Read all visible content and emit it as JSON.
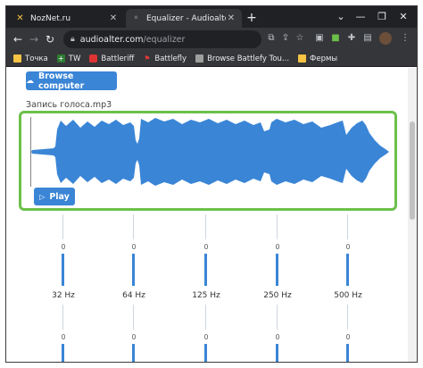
{
  "tabs": [
    {
      "title": "NozNet.ru",
      "icon": "noznet-favicon",
      "active": false
    },
    {
      "title": "Equalizer - Audioalter",
      "icon": "audioalter-favicon",
      "active": true
    }
  ],
  "toolbar": {
    "url_host": "audioalter.com",
    "url_path": "/equalizer"
  },
  "bookmarks": [
    {
      "label": "Точка",
      "icon": "folder-icon"
    },
    {
      "label": "TW",
      "icon": "plus-icon"
    },
    {
      "label": "Battleriff",
      "icon": "battleriff-icon"
    },
    {
      "label": "Battlefly",
      "icon": "battlefly-icon"
    },
    {
      "label": "Browse Battlefy Tou...",
      "icon": "battlefy-icon"
    },
    {
      "label": "Фермы",
      "icon": "folder-icon"
    }
  ],
  "page": {
    "browse_label": "Browse computer",
    "filename": "Запись голоса.mp3",
    "play_label": "Play"
  },
  "equalizer": {
    "row1": [
      {
        "freq": "32 Hz",
        "value": "0"
      },
      {
        "freq": "64 Hz",
        "value": "0"
      },
      {
        "freq": "125 Hz",
        "value": "0"
      },
      {
        "freq": "250 Hz",
        "value": "0"
      },
      {
        "freq": "500 Hz",
        "value": "0"
      }
    ],
    "row2": [
      {
        "value": "0"
      },
      {
        "value": "0"
      },
      {
        "value": "0"
      },
      {
        "value": "0"
      },
      {
        "value": "0"
      }
    ]
  },
  "colors": {
    "accent": "#3a85d6",
    "highlight": "#6cc04a",
    "waveform": "#3a85d6"
  }
}
